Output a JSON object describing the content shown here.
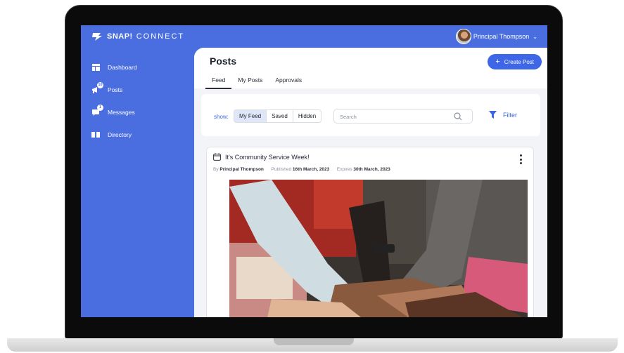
{
  "app": {
    "brand_bold": "SNAP!",
    "brand_light": "CONNECT"
  },
  "user": {
    "name": "Principal Thompson"
  },
  "sidebar": {
    "items": [
      {
        "label": "Dashboard",
        "icon": "dashboard-icon"
      },
      {
        "label": "Posts",
        "icon": "posts-icon",
        "badge": "10"
      },
      {
        "label": "Messages",
        "icon": "messages-icon",
        "badge": "1"
      },
      {
        "label": "Directory",
        "icon": "directory-icon"
      }
    ]
  },
  "page": {
    "title": "Posts",
    "create_label": "Create Post",
    "tabs": [
      "Feed",
      "My Posts",
      "Approvals"
    ],
    "active_tab": "Feed"
  },
  "filters": {
    "show_label": "show:",
    "options": [
      "My Feed",
      "Saved",
      "Hidden"
    ],
    "selected": "My Feed",
    "search_placeholder": "Search",
    "filter_label": "Filter"
  },
  "post": {
    "title": "It's Community Service Week!",
    "by_label": "By",
    "author": "Principal Thompson",
    "published_label": "Published",
    "published": "16th March, 2023",
    "expires_label": "Expires",
    "expires": "30th March, 2023"
  },
  "colors": {
    "accent": "#4a6ee0",
    "button": "#3d67e6"
  }
}
